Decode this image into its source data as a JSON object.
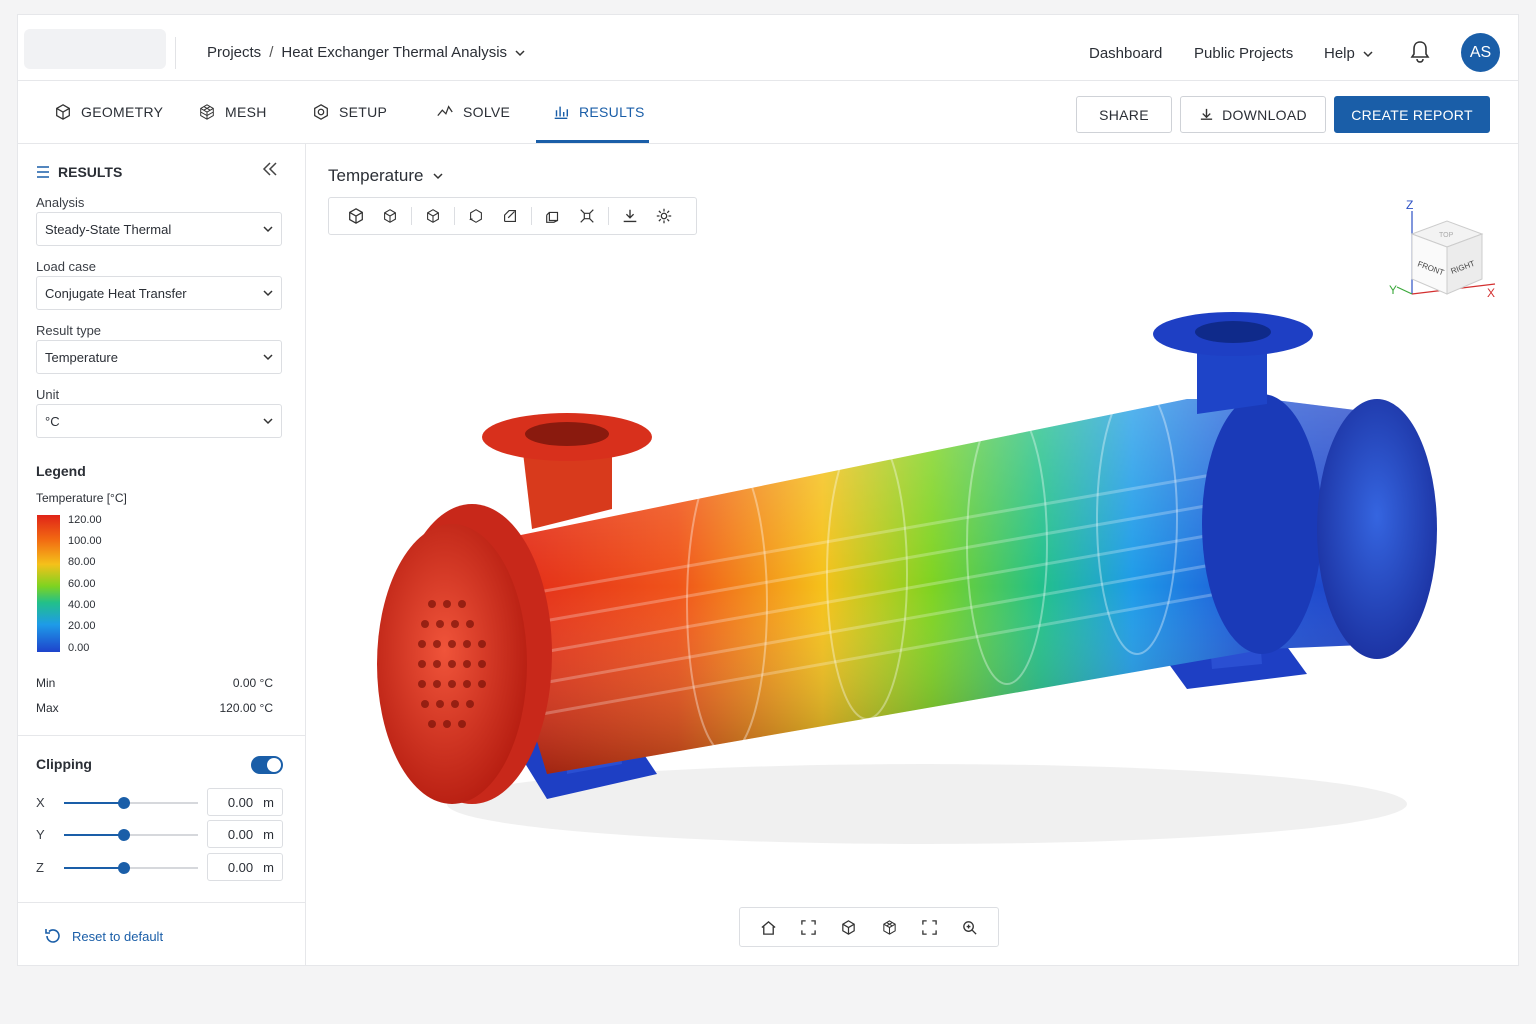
{
  "breadcrumb": {
    "projects": "Projects",
    "separator": "/",
    "project": "Heat Exchanger Thermal Analysis"
  },
  "nav": {
    "dashboard": "Dashboard",
    "public_projects": "Public Projects",
    "help": "Help"
  },
  "user": {
    "initials": "AS"
  },
  "tabs": [
    {
      "label": "GEOMETRY",
      "icon": "cube-icon"
    },
    {
      "label": "MESH",
      "icon": "mesh-icon"
    },
    {
      "label": "SETUP",
      "icon": "setup-icon"
    },
    {
      "label": "SOLVE",
      "icon": "solve-icon"
    },
    {
      "label": "RESULTS",
      "icon": "bar-chart-icon",
      "active": true
    }
  ],
  "actions": {
    "share": "SHARE",
    "download": "DOWNLOAD",
    "create_report": "CREATE REPORT"
  },
  "sidebar": {
    "title": "RESULTS",
    "fields": [
      {
        "label": "Analysis",
        "value": "Steady-State Thermal"
      },
      {
        "label": "Load case",
        "value": "Conjugate Heat Transfer"
      },
      {
        "label": "Result type",
        "value": "Temperature"
      },
      {
        "label": "Unit",
        "value": "°C"
      }
    ],
    "legend": {
      "title": "Legend",
      "subtitle": "Temperature [°C]",
      "ticks": [
        "120.00",
        "100.00",
        "80.00",
        "60.00",
        "40.00",
        "20.00",
        "0.00"
      ],
      "min_label": "Min",
      "min_value": "0.00 °C",
      "max_label": "Max",
      "max_value": "120.00 °C"
    },
    "clipping": {
      "title": "Clipping",
      "enabled": true,
      "axes": [
        {
          "label": "X",
          "value": "0.00",
          "unit": "m",
          "position": 0.45
        },
        {
          "label": "Y",
          "value": "0.00",
          "unit": "m",
          "position": 0.45
        },
        {
          "label": "Z",
          "value": "0.00",
          "unit": "m",
          "position": 0.45
        }
      ]
    },
    "reset_label": "Reset to default"
  },
  "viewport": {
    "result_title": "Temperature",
    "viewcube": {
      "top": "TOP",
      "front": "FRONT",
      "right": "RIGHT",
      "axis_x": "X",
      "axis_y": "Y",
      "axis_z": "Z"
    }
  },
  "colors": {
    "accent": "#1a5ea8",
    "hot": "#e02418",
    "cold": "#1e43cc"
  }
}
